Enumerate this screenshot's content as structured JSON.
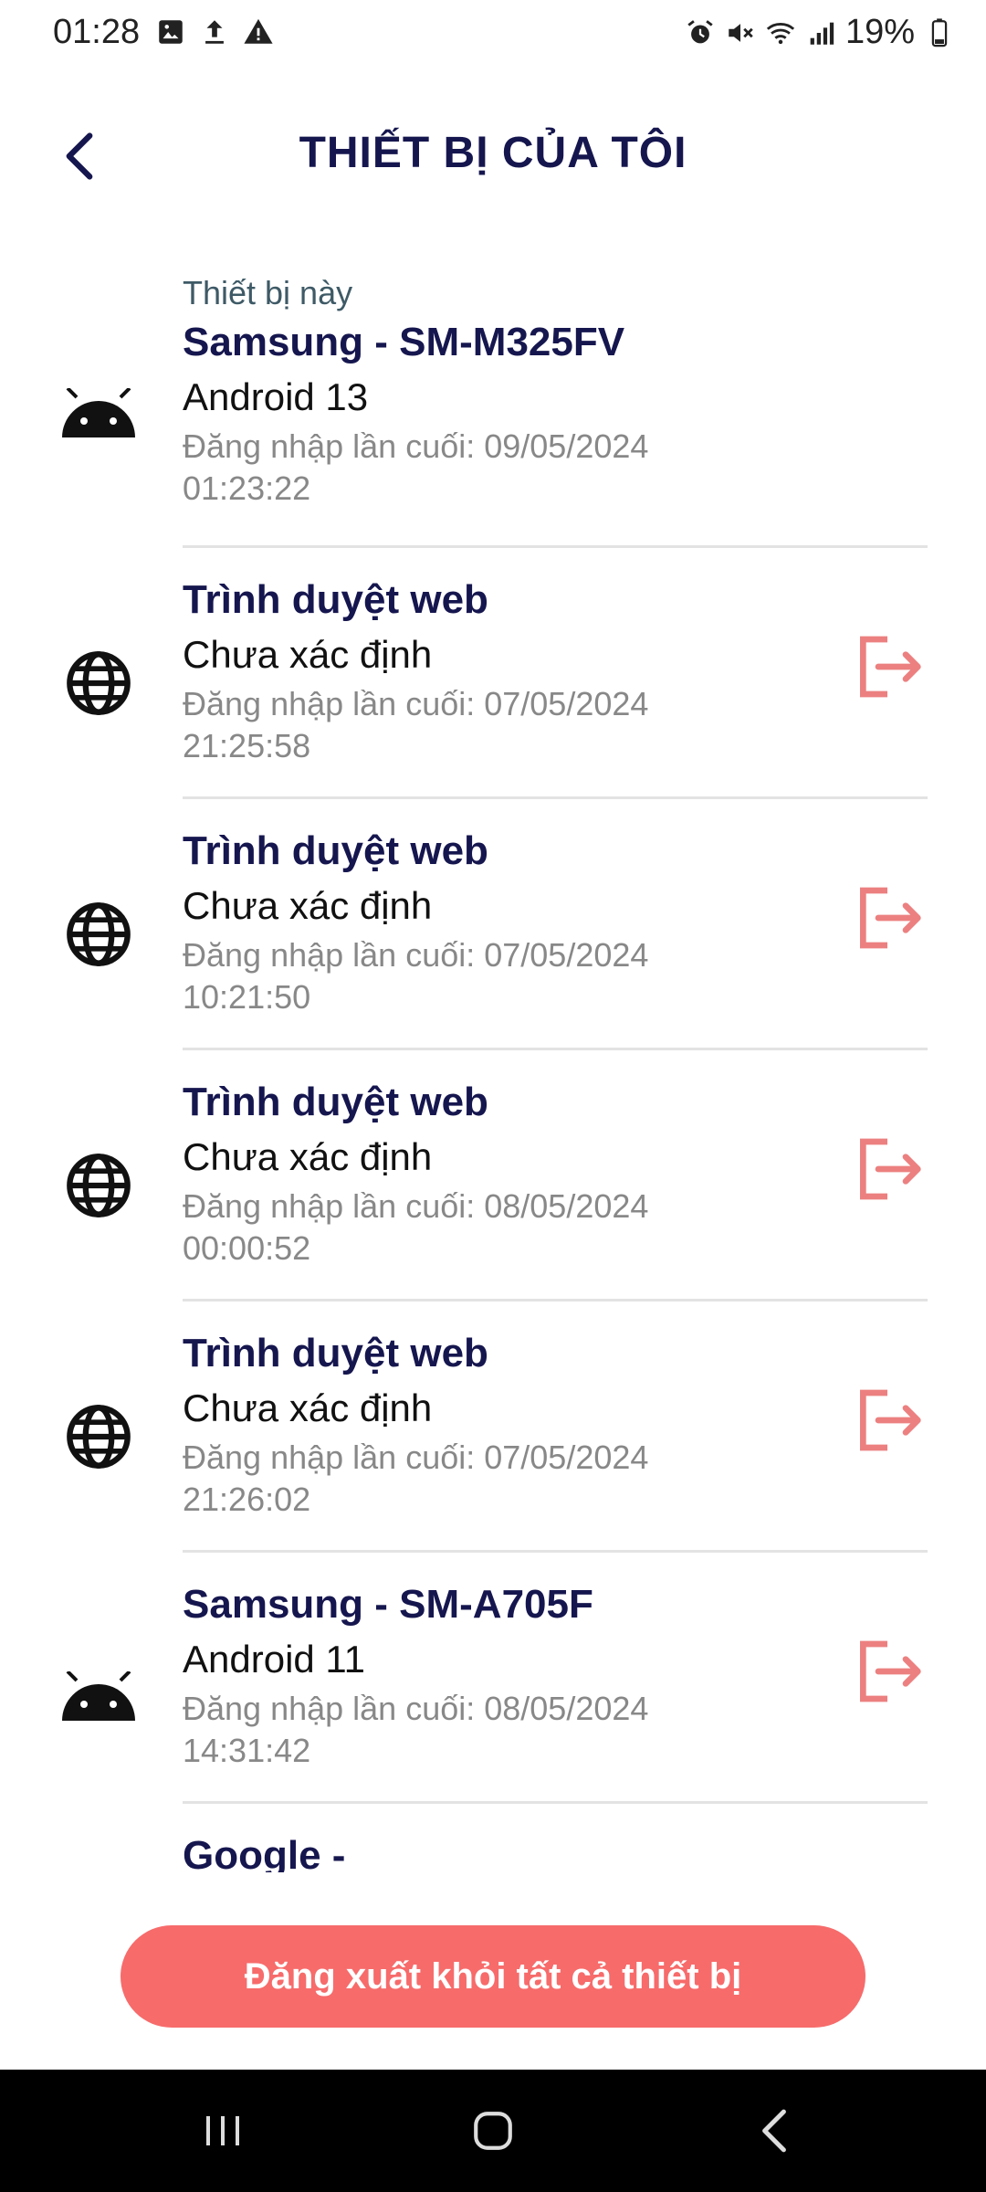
{
  "status_bar": {
    "time": "01:28",
    "battery": "19%",
    "icons_left": [
      "image-icon",
      "upload-icon",
      "warning-icon"
    ],
    "icons_right": [
      "alarm-icon",
      "mute-icon",
      "wifi-icon",
      "signal-icon",
      "battery-icon"
    ]
  },
  "header": {
    "title": "THIẾT BỊ CỦA TÔI",
    "back_icon": "chevron-left-icon"
  },
  "devices": [
    {
      "subhead": "Thiết bị này",
      "name": "Samsung - SM-M325FV",
      "os": "Android 13",
      "login": "Đăng nhập lần cuối: 09/05/2024 01:23:22",
      "icon": "android-icon",
      "can_logout": false
    },
    {
      "name": "Trình duyệt web",
      "os": "Chưa xác định",
      "login": "Đăng nhập lần cuối: 07/05/2024 21:25:58",
      "icon": "globe-icon",
      "can_logout": true
    },
    {
      "name": "Trình duyệt web",
      "os": "Chưa xác định",
      "login": "Đăng nhập lần cuối: 07/05/2024 10:21:50",
      "icon": "globe-icon",
      "can_logout": true
    },
    {
      "name": "Trình duyệt web",
      "os": "Chưa xác định",
      "login": "Đăng nhập lần cuối: 08/05/2024 00:00:52",
      "icon": "globe-icon",
      "can_logout": true
    },
    {
      "name": "Trình duyệt web",
      "os": "Chưa xác định",
      "login": "Đăng nhập lần cuối: 07/05/2024 21:26:02",
      "icon": "globe-icon",
      "can_logout": true
    },
    {
      "name": "Samsung - SM-A705F",
      "os": "Android 11",
      "login": "Đăng nhập lần cuối: 08/05/2024 14:31:42",
      "icon": "android-icon",
      "can_logout": true
    },
    {
      "name": "Google -",
      "icon": "android-icon",
      "can_logout": false
    }
  ],
  "logout_all_label": "Đăng xuất khỏi tất cả thiết bị",
  "colors": {
    "title": "#16164f",
    "accent_red": "#f76b6b",
    "logout_icon": "#ec8080"
  },
  "nav_bar": [
    "recent-apps-icon",
    "home-icon",
    "back-icon"
  ]
}
